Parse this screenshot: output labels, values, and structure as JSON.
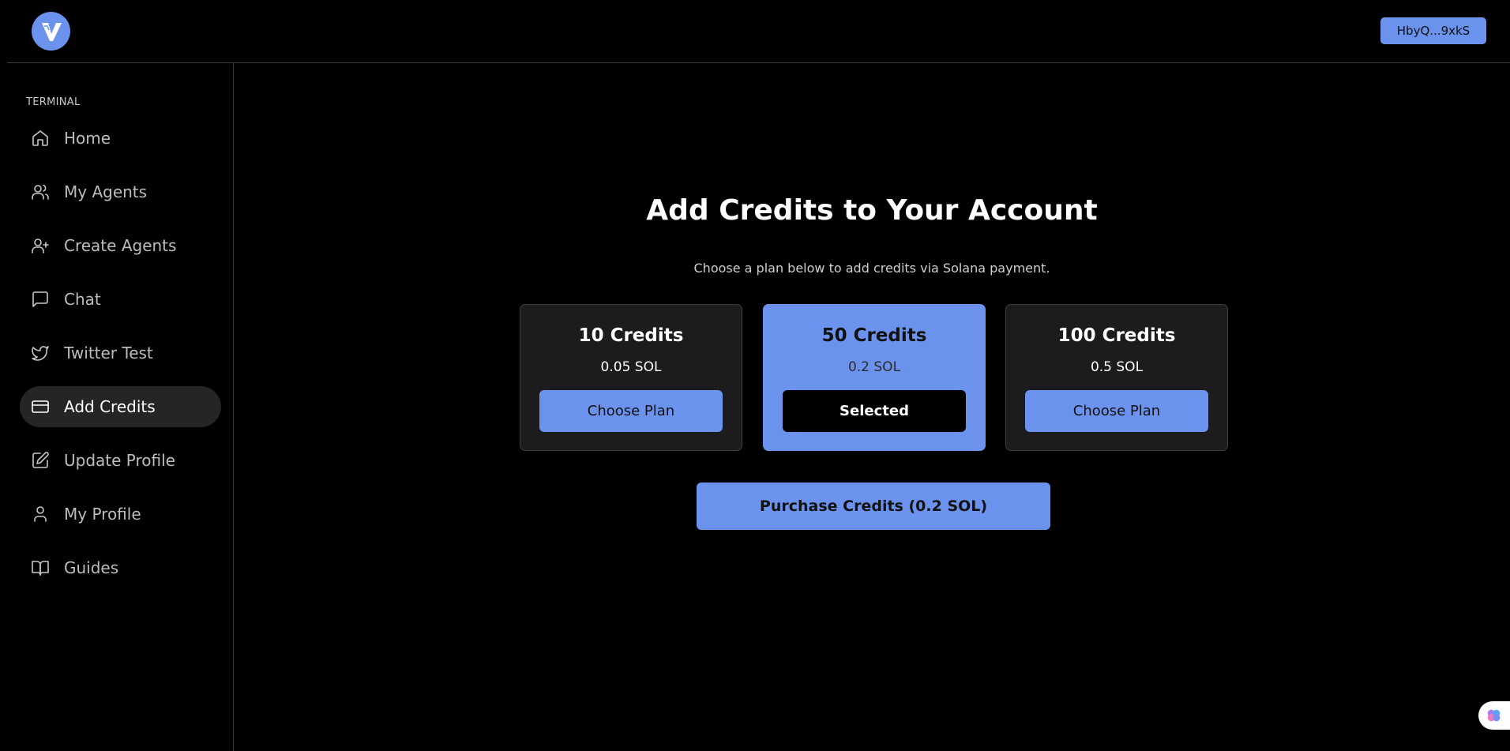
{
  "header": {
    "logo_alt": "V",
    "wallet_label": "HbyQ...9xkS"
  },
  "sidebar": {
    "section_label": "TERMINAL",
    "items": [
      {
        "label": "Home",
        "icon": "home-icon"
      },
      {
        "label": "My Agents",
        "icon": "users-icon"
      },
      {
        "label": "Create Agents",
        "icon": "user-plus-icon"
      },
      {
        "label": "Chat",
        "icon": "message-square-icon"
      },
      {
        "label": "Twitter Test",
        "icon": "twitter-icon"
      },
      {
        "label": "Add Credits",
        "icon": "credit-card-icon",
        "active": true
      },
      {
        "label": "Update Profile",
        "icon": "edit-icon"
      },
      {
        "label": "My Profile",
        "icon": "user-icon"
      },
      {
        "label": "Guides",
        "icon": "book-open-icon"
      }
    ]
  },
  "main": {
    "title": "Add Credits to Your Account",
    "subtitle": "Choose a plan below to add credits via Solana payment.",
    "plans": [
      {
        "name": "10 Credits",
        "price": "0.05 SOL",
        "button": "Choose Plan",
        "selected": false
      },
      {
        "name": "50 Credits",
        "price": "0.2 SOL",
        "button": "Selected",
        "selected": true
      },
      {
        "name": "100 Credits",
        "price": "0.5 SOL",
        "button": "Choose Plan",
        "selected": false
      }
    ],
    "purchase_label": "Purchase Credits (0.2 SOL)"
  },
  "colors": {
    "accent": "#6b93ee",
    "background": "#000000",
    "card": "#1c1c1e",
    "active_nav": "#252528"
  }
}
